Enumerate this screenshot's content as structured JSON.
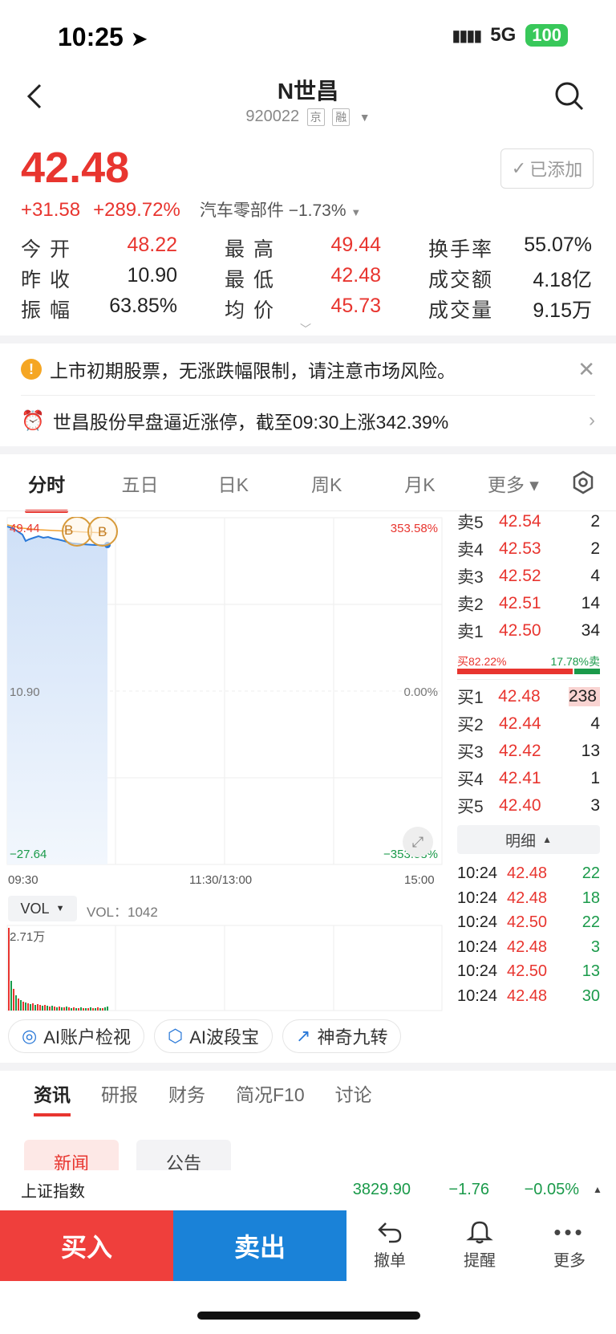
{
  "status": {
    "time": "10:25",
    "network": "5G",
    "battery": "100"
  },
  "header": {
    "title": "N世昌",
    "code": "920022",
    "tag1": "京",
    "tag2": "融"
  },
  "quote": {
    "price": "42.48",
    "change": "+31.58",
    "change_pct": "+289.72%",
    "sector": "汽车零部件",
    "sector_pct": "−1.73%",
    "added_label": "已添加"
  },
  "stats": [
    [
      {
        "label": "今 开",
        "value": "48.22",
        "color": "red"
      },
      {
        "label": "最 高",
        "value": "49.44",
        "color": "red"
      },
      {
        "label": "换手率",
        "value": "55.07%",
        "color": "dark"
      }
    ],
    [
      {
        "label": "昨 收",
        "value": "10.90",
        "color": "dark"
      },
      {
        "label": "最 低",
        "value": "42.48",
        "color": "red"
      },
      {
        "label": "成交额",
        "value": "4.18亿",
        "color": "dark"
      }
    ],
    [
      {
        "label": "振 幅",
        "value": "63.85%",
        "color": "dark"
      },
      {
        "label": "均 价",
        "value": "45.73",
        "color": "red"
      },
      {
        "label": "成交量",
        "value": "9.15万",
        "color": "dark"
      }
    ]
  ],
  "notices": {
    "warning": "上市初期股票，无涨跌幅限制，请注意市场风险。",
    "alert": "世昌股份早盘逼近涨停，截至09:30上涨342.39%"
  },
  "tabs": [
    "分时",
    "五日",
    "日K",
    "周K",
    "月K",
    "更多"
  ],
  "chart": {
    "y_top_left": "49.44",
    "y_top_right": "353.58%",
    "y_mid_left": "10.90",
    "y_mid_right": "0.00%",
    "y_bot_left": "−27.64",
    "y_bot_right": "−353.58%",
    "x_labels": [
      "09:30",
      "11:30/13:00",
      "15:00"
    ],
    "markers": [
      "B",
      "B"
    ],
    "vol_selector": "VOL",
    "vol_value": "VOL：1042",
    "vol_max": "2.71万"
  },
  "orderbook": {
    "asks": [
      {
        "label": "卖5",
        "price": "42.54",
        "vol": "2"
      },
      {
        "label": "卖4",
        "price": "42.53",
        "vol": "2"
      },
      {
        "label": "卖3",
        "price": "42.52",
        "vol": "4"
      },
      {
        "label": "卖2",
        "price": "42.51",
        "vol": "14"
      },
      {
        "label": "卖1",
        "price": "42.50",
        "vol": "34"
      }
    ],
    "buy_ratio": "买82.22%",
    "sell_ratio": "17.78%卖",
    "buy_ratio_value": 0.8222,
    "bids": [
      {
        "label": "买1",
        "price": "42.48",
        "vol": "238"
      },
      {
        "label": "买2",
        "price": "42.44",
        "vol": "4"
      },
      {
        "label": "买3",
        "price": "42.42",
        "vol": "13"
      },
      {
        "label": "买4",
        "price": "42.41",
        "vol": "1"
      },
      {
        "label": "买5",
        "price": "42.40",
        "vol": "3"
      }
    ],
    "detail_label": "明细"
  },
  "ticks": [
    {
      "time": "10:24",
      "price": "42.48",
      "vol": "22"
    },
    {
      "time": "10:24",
      "price": "42.48",
      "vol": "18"
    },
    {
      "time": "10:24",
      "price": "42.50",
      "vol": "22"
    },
    {
      "time": "10:24",
      "price": "42.48",
      "vol": "3"
    },
    {
      "time": "10:24",
      "price": "42.50",
      "vol": "13"
    },
    {
      "time": "10:24",
      "price": "42.48",
      "vol": "30"
    }
  ],
  "ai_buttons": [
    "AI账户检视",
    "AI波段宝",
    "神奇九转"
  ],
  "news_tabs": [
    "资讯",
    "研报",
    "财务",
    "简况F10",
    "讨论"
  ],
  "sub_tabs": [
    "新闻",
    "公告"
  ],
  "index_bar": {
    "name": "上证指数",
    "value": "3829.90",
    "change": "−1.76",
    "pct": "−0.05%"
  },
  "bottom": {
    "buy": "买入",
    "sell": "卖出",
    "cancel": "撤单",
    "remind": "提醒",
    "more": "更多"
  }
}
